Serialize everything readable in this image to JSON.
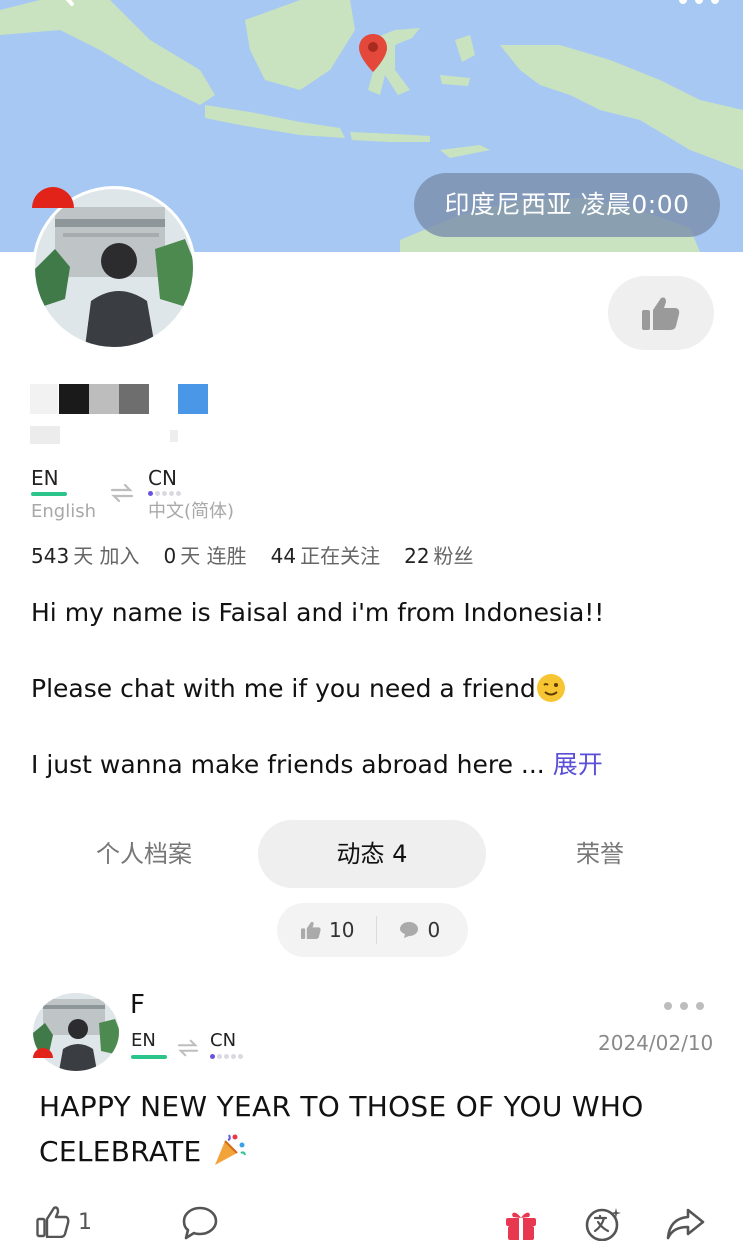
{
  "header": {
    "location_label": "印度尼西亚  凌晨0:00",
    "colors": {
      "sea": "#a7c8f2",
      "land": "#c9e3c0",
      "pin": "#e4483a"
    }
  },
  "profile": {
    "languages": {
      "native": {
        "code": "EN",
        "name": "English"
      },
      "learning": {
        "code": "CN",
        "name": "中文(简体)"
      }
    },
    "stats": [
      {
        "value": "543",
        "label": "天 加入"
      },
      {
        "value": "0",
        "label": "天 连胜"
      },
      {
        "value": "44",
        "label": "正在关注"
      },
      {
        "value": "22",
        "label": "粉丝"
      }
    ],
    "bio": {
      "line1": "Hi my name is Faisal and i'm from Indonesia!!",
      "line2": "Please chat with me if you need a friend",
      "line3": "I just wanna make friends abroad here ...",
      "expand_label": "展开"
    }
  },
  "tabs": [
    {
      "label": "个人档案",
      "active": false
    },
    {
      "label": "动态 4",
      "active": true
    },
    {
      "label": "荣誉",
      "active": false
    }
  ],
  "totals": {
    "likes": "10",
    "comments": "0"
  },
  "post": {
    "author_initial": "F",
    "native_code": "EN",
    "learning_code": "CN",
    "date": "2024/02/10",
    "text": "HAPPY NEW YEAR TO THOSE OF YOU WHO CELEBRATE",
    "like_count": "1"
  },
  "colors": {
    "accent": "#5a4fd6",
    "green": "#2bc48a",
    "gift": "#e8384f"
  }
}
